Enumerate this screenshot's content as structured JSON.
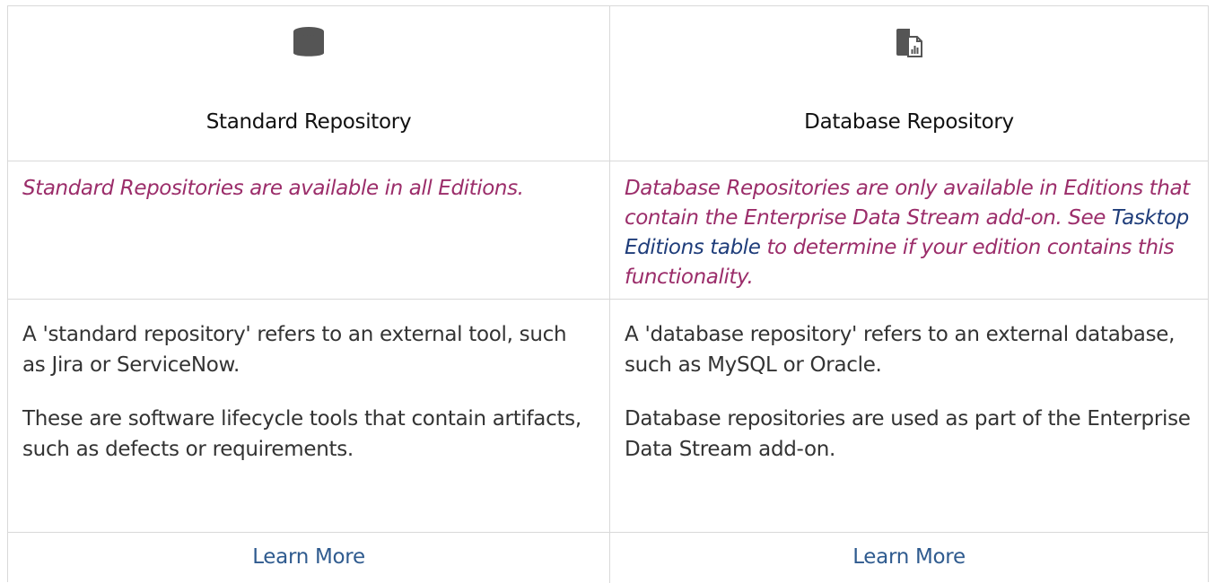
{
  "columns": [
    {
      "icon": "database-cylinder-icon",
      "heading": "Standard Repository",
      "note": {
        "text": "Standard Repositories are available in all Editions."
      },
      "description": [
        "A 'standard repository' refers to an external tool, such as Jira or ServiceNow.",
        "These are software lifecycle tools that contain artifacts, such as defects or requirements."
      ],
      "learn_more": "Learn More"
    },
    {
      "icon": "database-report-icon",
      "heading": "Database Repository",
      "note": {
        "text_before": "Database Repositories are only available in Editions that contain the Enterprise Data Stream add-on.  See ",
        "link": "Tasktop Editions table",
        "text_after": " to determine if your edition contains this functionality."
      },
      "description": [
        "A 'database repository' refers to an external database, such as MySQL or Oracle.",
        "Database repositories are used as part of the Enterprise Data Stream add-on."
      ],
      "learn_more": "Learn More"
    }
  ],
  "colors": {
    "note": "#9b2d6a",
    "link": "#1f3d7a",
    "learn_more": "#2f5b8f",
    "border": "#d9d9d9",
    "icon": "#555555"
  }
}
